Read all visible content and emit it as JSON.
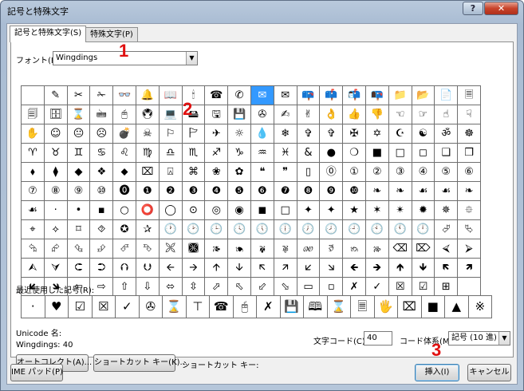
{
  "window": {
    "title": "記号と特殊文字",
    "help_label": "?",
    "close_label": "✕"
  },
  "tabs": [
    {
      "label": "記号と特殊文字(S)"
    },
    {
      "label": "特殊文字(P)"
    }
  ],
  "font": {
    "label": "フォント(F):",
    "value": "Wingdings"
  },
  "symbol_grid": {
    "selected_index": 10,
    "cells": [
      "",
      "✎",
      "✂",
      "✁",
      "👓",
      "🔔",
      "📖",
      "🕯",
      "☎",
      "✆",
      "✉",
      "✉",
      "📪",
      "📫",
      "📬",
      "📭",
      "📁",
      "📂",
      "📄",
      "🗏",
      "🗐",
      "🗄",
      "⌛",
      "🖮",
      "🖰",
      "🖲",
      "💻",
      "🖴",
      "🖫",
      "💾",
      "✇",
      "✍",
      "✌",
      "👌",
      "👍",
      "👎",
      "☜",
      "☞",
      "☝",
      "☟",
      "✋",
      "☺",
      "😐",
      "☹",
      "💣",
      "☠",
      "⚐",
      "🏱",
      "✈",
      "☼",
      "💧",
      "❄",
      "✞",
      "✞",
      "✠",
      "✡",
      "☪",
      "☯",
      "ॐ",
      "☸",
      "♈",
      "♉",
      "♊",
      "♋",
      "♌",
      "♍",
      "♎",
      "♏",
      "♐",
      "♑",
      "♒",
      "♓",
      "&",
      "●",
      "❍",
      "■",
      "□",
      "◻",
      "❑",
      "❒",
      "⬧",
      "⧫",
      "◆",
      "❖",
      "⬥",
      "⌧",
      "⍓",
      "⌘",
      "❀",
      "✿",
      "❝",
      "❞",
      "▯",
      "⓪",
      "①",
      "②",
      "③",
      "④",
      "⑤",
      "⑥",
      "⑦",
      "⑧",
      "⑨",
      "⑩",
      "⓿",
      "❶",
      "❷",
      "❸",
      "❹",
      "❺",
      "❻",
      "❼",
      "❽",
      "❾",
      "❿",
      "❧",
      "❧",
      "☙",
      "☙",
      "❧",
      "☙",
      "·",
      "•",
      "▪",
      "○",
      "⭕",
      "◯",
      "⊙",
      "◎",
      "◉",
      "◼",
      "□",
      "✦",
      "✦",
      "★",
      "✶",
      "✴",
      "✹",
      "✵",
      "⯐",
      "⌖",
      "⟡",
      "⌑",
      "⯑",
      "✪",
      "✰",
      "🕐",
      "🕑",
      "🕒",
      "🕓",
      "🕔",
      "🕕",
      "🕖",
      "🕗",
      "🕘",
      "🕙",
      "🕚",
      "🕛",
      "⮰",
      "⮱",
      "⮲",
      "⮳",
      "⮴",
      "⮵",
      "⮶",
      "⮷",
      "🙪",
      "🙫",
      "🙕",
      "🙔",
      "🙗",
      "🙖",
      "🙐",
      "🙑",
      "🙒",
      "🙓",
      "⌫",
      "⌦",
      "⮘",
      "⮚",
      "⮙",
      "⮛",
      "⮈",
      "⮊",
      "⮉",
      "⮋",
      "🡨",
      "🡪",
      "🡩",
      "🡫",
      "🡬",
      "🡭",
      "🡯",
      "🡮",
      "🡸",
      "🡺",
      "🡹",
      "🡻",
      "🡼",
      "🡽",
      "🡿",
      "🡾",
      "⇦",
      "⇨",
      "⇧",
      "⇩",
      "⬄",
      "⇳",
      "⬀",
      "⬁",
      "⬃",
      "⬂",
      "▭",
      "▫",
      "✗",
      "✓",
      "☒",
      "☑",
      "⊞",
      ""
    ]
  },
  "recent": {
    "label": "最近使用した記号(R):",
    "cells": [
      "·",
      "♥",
      "☑",
      "☒",
      "✓",
      "✇",
      "⌛",
      "⊤",
      "☎",
      "🖰",
      "✗",
      "💾",
      "🕮",
      "⌛",
      "🗏",
      "🖐",
      "⌧",
      "■",
      "▲",
      "※",
      "◎",
      "○",
      "△"
    ]
  },
  "unicode_name": {
    "label": "Unicode 名:",
    "value": "Wingdings: 40"
  },
  "char_code": {
    "label": "文字コード(C):",
    "value": "40"
  },
  "encoding": {
    "label": "コード体系(M):",
    "value": "記号 (10 進)"
  },
  "buttons": {
    "autocorrect": "オートコレクト(A)...",
    "shortcut_key": "ショートカット キー(K)...",
    "shortcut_label": "ショートカット キー:",
    "ime_pad": "IME パッド(P)",
    "insert": "挿入(I)",
    "cancel": "キャンセル"
  },
  "markers": [
    "1",
    "2",
    "3"
  ],
  "colors": {
    "selection": "#3399ff",
    "marker": "#e01010"
  }
}
